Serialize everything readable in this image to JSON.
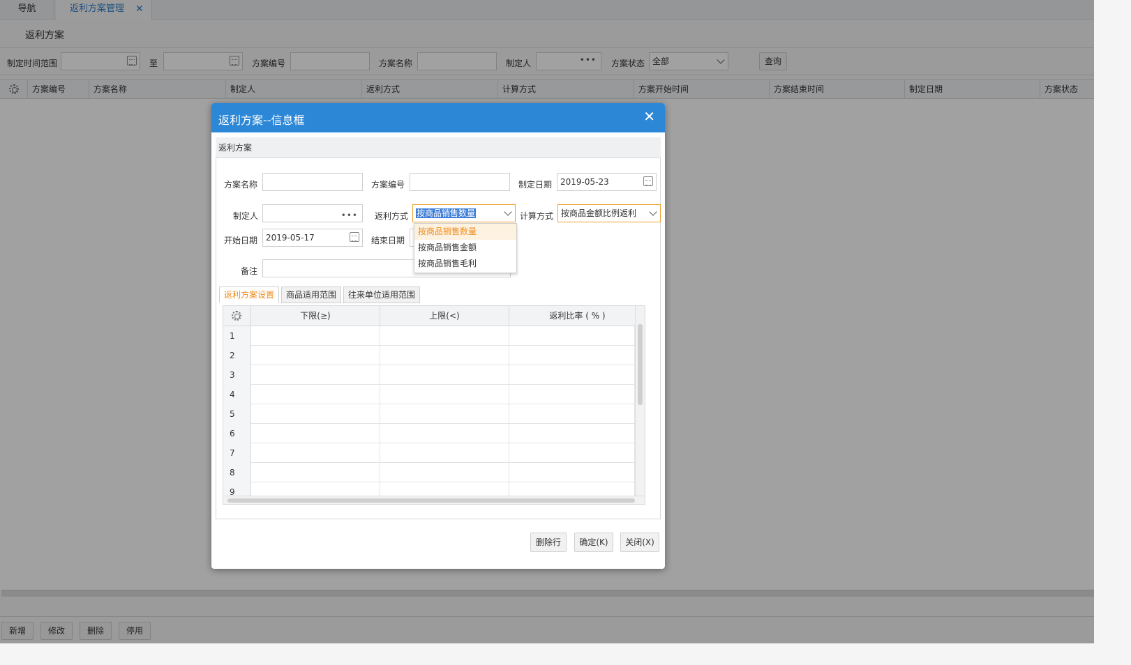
{
  "tabs": {
    "nav_label": "导航",
    "active_label": "返利方案管理",
    "close_symbol": "✕"
  },
  "page": {
    "title": "返利方案"
  },
  "filter": {
    "date_range_label": "制定时间范围",
    "to_label": "至",
    "code_label": "方案编号",
    "name_label": "方案名称",
    "maker_label": "制定人",
    "status_label": "方案状态",
    "status_value": "全部",
    "query_button": "查询",
    "dots": "•••"
  },
  "grid": {
    "columns": [
      "方案编号",
      "方案名称",
      "制定人",
      "返利方式",
      "计算方式",
      "方案开始时间",
      "方案结束时间",
      "制定日期",
      "方案状态"
    ]
  },
  "bottom": {
    "buttons": [
      "新增",
      "修改",
      "删除",
      "停用"
    ]
  },
  "dialog": {
    "title": "返利方案--信息框",
    "close_symbol": "✕",
    "section_title": "返利方案",
    "name_label": "方案名称",
    "code_label": "方案编号",
    "date_label": "制定日期",
    "date_value": "2019-05-23",
    "maker_label": "制定人",
    "rebate_mode_label": "返利方式",
    "rebate_mode_value": "按商品销售数量",
    "calc_mode_label": "计算方式",
    "calc_mode_value": "按商品金额比例返利",
    "start_label": "开始日期",
    "start_value": "2019-05-17",
    "end_label": "结束日期",
    "remark_label": "备注",
    "dots": "•••",
    "dropdown_options": [
      "按商品销售数量",
      "按商品销售金额",
      "按商品销售毛利"
    ],
    "subtabs": [
      "返利方案设置",
      "商品适用范围",
      "往来单位适用范围"
    ],
    "inner_columns": [
      "下限(≥)",
      "上限(<)",
      "返利比率 ( % )"
    ],
    "rows": [
      "1",
      "2",
      "3",
      "4",
      "5",
      "6",
      "7",
      "8",
      "9"
    ],
    "buttons": {
      "delete_row": "删除行",
      "confirm": "确定(K)",
      "close": "关闭(X)"
    }
  },
  "colors": {
    "header_blue": "#2c87d6",
    "accent_orange": "#f08c1e",
    "tab_blue": "#2f7fc6"
  }
}
